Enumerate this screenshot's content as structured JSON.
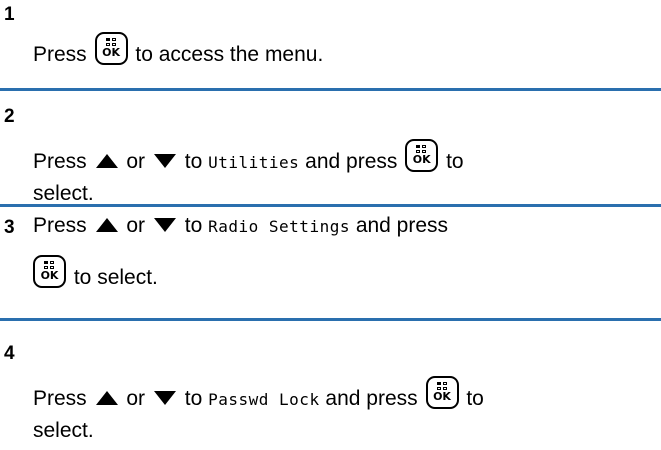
{
  "ok_key_label": "OK",
  "colors": {
    "divider": "#2a6fae",
    "text": "#000000"
  },
  "icons": {
    "ok_key": "menu-ok-key-icon",
    "up": "up-arrow-icon",
    "down": "down-arrow-icon"
  },
  "steps": [
    {
      "number": "1",
      "press": "Press",
      "after_key": "to access the menu."
    },
    {
      "number": "2",
      "press": "Press",
      "or": "or",
      "to": "to",
      "menu_item": "Utilities",
      "and_press": "and press",
      "to_select_a": "to",
      "to_select_b": "select."
    },
    {
      "number": "3",
      "press": "Press",
      "or": "or",
      "to": "to",
      "menu_item": "Radio Settings",
      "and_press": "and press",
      "to_select": "to select."
    },
    {
      "number": "4",
      "press": "Press",
      "or": "or",
      "to": "to",
      "menu_item": "Passwd Lock",
      "and_press": "and press",
      "to_select_a": "to",
      "to_select_b": "select."
    }
  ]
}
